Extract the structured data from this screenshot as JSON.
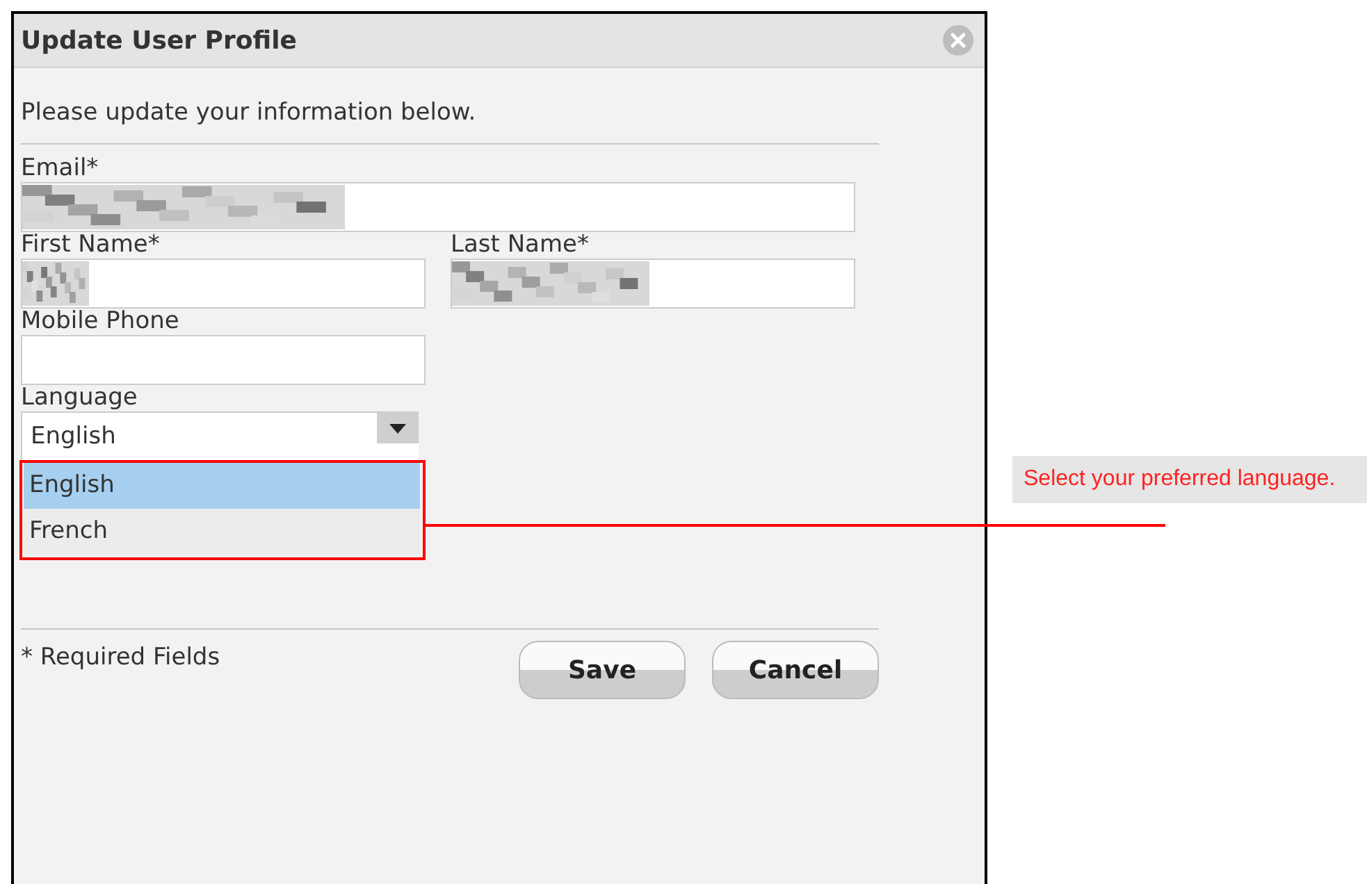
{
  "dialog": {
    "title": "Update User Profile",
    "intro": "Please update your information below.",
    "fields": [
      {
        "label": "Email*",
        "kind": "wide",
        "redacted": true
      },
      {
        "label": "First Name*",
        "kind": "narrow",
        "redacted": true
      },
      {
        "label": "Last Name*",
        "kind": "narrow",
        "redacted": true
      },
      {
        "label": "Mobile Phone",
        "kind": "narrow",
        "redacted": false
      }
    ],
    "language": {
      "label": "Language",
      "value": "English",
      "expanded": true,
      "options": [
        {
          "label": "English",
          "selected": true
        },
        {
          "label": "French",
          "selected": false
        }
      ]
    },
    "required_note": "* Required Fields",
    "buttons": [
      "Save",
      "Cancel"
    ]
  },
  "callout": {
    "text": "Select your preferred language."
  }
}
